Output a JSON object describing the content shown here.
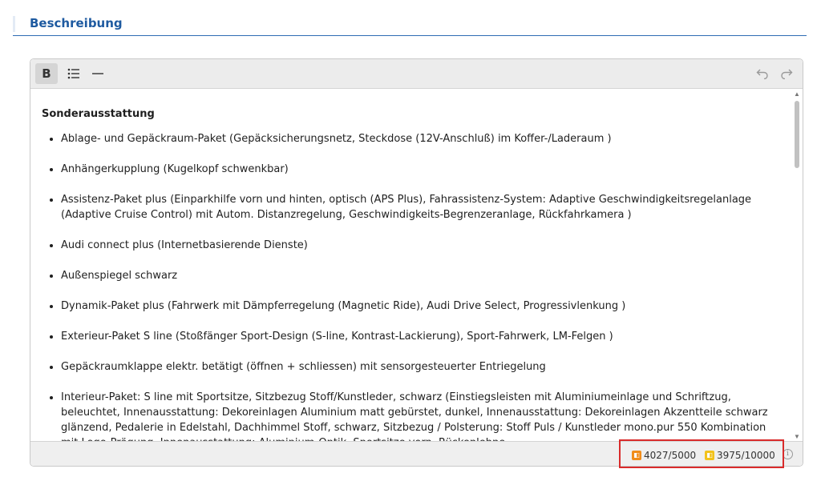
{
  "section": {
    "title": "Beschreibung"
  },
  "toolbar": {
    "bold_label": "B",
    "icons": [
      "bullet-list-icon",
      "horizontal-rule-icon",
      "undo-icon",
      "redo-icon"
    ]
  },
  "content": {
    "heading": "Sonderausstattung",
    "items": [
      "Ablage- und Gepäckraum-Paket (Gepäcksicherungsnetz, Steckdose (12V-Anschluß) im Koffer-/Laderaum )",
      "Anhängerkupplung (Kugelkopf schwenkbar)",
      "Assistenz-Paket plus (Einparkhilfe vorn und hinten, optisch (APS Plus), Fahrassistenz-System: Adaptive Geschwindigkeitsregelanlage (Adaptive Cruise Control) mit Autom. Distanzregelung, Geschwindigkeits-Begrenzeranlage, Rückfahrkamera )",
      "Audi connect plus (Internetbasierende Dienste)",
      "Außenspiegel schwarz",
      "Dynamik-Paket plus (Fahrwerk mit Dämpferregelung (Magnetic Ride), Audi Drive Select, Progressivlenkung )",
      "Exterieur-Paket S line (Stoßfänger Sport-Design (S-line, Kontrast-Lackierung), Sport-Fahrwerk, LM-Felgen )",
      "Gepäckraumklappe elektr. betätigt (öffnen + schliessen) mit sensorgesteuerter Entriegelung",
      "Interieur-Paket: S line mit Sportsitze, Sitzbezug Stoff/Kunstleder, schwarz (Einstiegsleisten mit Aluminiumeinlage und Schriftzug, beleuchtet, Innenausstattung: Dekoreinlagen Aluminium matt gebürstet, dunkel, Innenausstattung: Dekoreinlagen Akzentteile schwarz glänzend, Pedalerie in Edelstahl, Dachhimmel Stoff, schwarz, Sitzbezug / Polsterung: Stoff Puls / Kunstleder mono.pur 550 Kombination mit Logo-Prägung, Innenausstattung: Aluminium-Optik, Sportsitze vorn, Rückenlehne"
    ]
  },
  "status": {
    "counter_1": "4027/5000",
    "counter_2": "3975/10000",
    "colors": {
      "counter_1_badge": "#f08c1a",
      "counter_2_badge": "#f2c21a",
      "highlight": "#d92b2b"
    }
  }
}
